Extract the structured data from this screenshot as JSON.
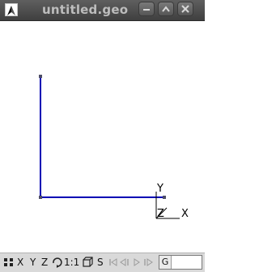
{
  "window": {
    "title": "untitled.geo",
    "icons": [
      "app-icon",
      "minimize-icon",
      "maximize-icon",
      "close-icon"
    ]
  },
  "viewport": {
    "axes_labels": {
      "y": "Y",
      "z": "Z",
      "x": "X"
    },
    "line_color": "#0000b4",
    "point_color": "#4d4d66"
  },
  "statusbar": {
    "x_label": "X",
    "y_label": "Y",
    "z_label": "Z",
    "scale_label": "1:1",
    "s_label": "S",
    "message_prefix": "G"
  }
}
